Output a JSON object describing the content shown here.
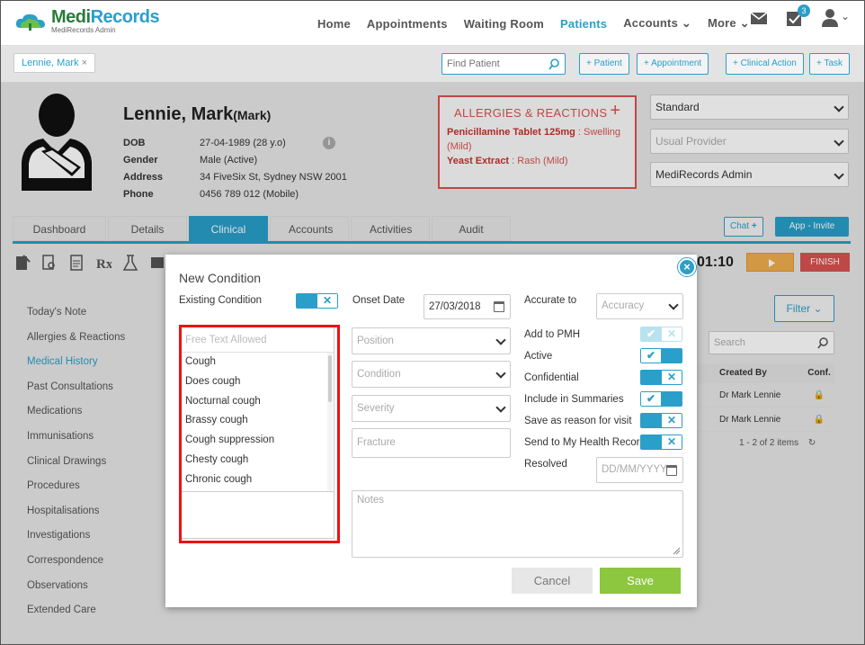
{
  "app": {
    "logo_title_1": "Medi",
    "logo_title_2": "Records",
    "logo_subtitle": "MediRecords Admin"
  },
  "nav": {
    "items": [
      {
        "label": "Home",
        "active": false
      },
      {
        "label": "Appointments",
        "active": false
      },
      {
        "label": "Waiting Room",
        "active": false
      },
      {
        "label": "Patients",
        "active": true
      },
      {
        "label": "Accounts",
        "active": false
      },
      {
        "label": "More",
        "active": false
      }
    ],
    "tasks_badge": "3",
    "accent": "#2a9fc9"
  },
  "toolbar": {
    "patient_chip": "Lennie, Mark",
    "find_placeholder": "Find Patient",
    "add_patient": "+ Patient",
    "add_appointment": "+ Appointment",
    "add_clinical_action": "+ Clinical Action",
    "add_task": "+ Task"
  },
  "patient": {
    "name": "Lennie, Mark",
    "preferred": "(Mark)",
    "fields": [
      {
        "key": "DOB",
        "value": "27-04-1989 (28 y.o)"
      },
      {
        "key": "Gender",
        "value": "Male (Active)"
      },
      {
        "key": "Address",
        "value": "34 FiveSix St, Sydney NSW 2001"
      },
      {
        "key": "Phone",
        "value": "0456 789 012 (Mobile)"
      }
    ]
  },
  "allergies": {
    "title": "ALLERGIES & REACTIONS",
    "items": [
      {
        "name": "Penicillamine Tablet 125mg",
        "reaction": "Swelling (Mild)"
      },
      {
        "name": "Yeast Extract",
        "reaction": "Rash (Mild)"
      }
    ],
    "color": "#d9534f"
  },
  "header_selects": {
    "type": "Standard",
    "provider_placeholder": "Usual Provider",
    "practice": "MediRecords Admin"
  },
  "tabs": [
    {
      "label": "Dashboard",
      "active": false
    },
    {
      "label": "Details",
      "active": false
    },
    {
      "label": "Clinical",
      "active": true
    },
    {
      "label": "Accounts",
      "active": false
    },
    {
      "label": "Activities",
      "active": false
    },
    {
      "label": "Audit",
      "active": false
    }
  ],
  "chat_label": "Chat",
  "invite_label": "App - Invite",
  "timer": "01:10",
  "finish_label": "FINISH",
  "left_menu": [
    {
      "label": "Today's Note",
      "active": false
    },
    {
      "label": "Allergies & Reactions",
      "active": false
    },
    {
      "label": "Medical History",
      "active": true
    },
    {
      "label": "Past Consultations",
      "active": false
    },
    {
      "label": "Medications",
      "active": false
    },
    {
      "label": "Immunisations",
      "active": false
    },
    {
      "label": "Clinical Drawings",
      "active": false
    },
    {
      "label": "Procedures",
      "active": false
    },
    {
      "label": "Hospitalisations",
      "active": false
    },
    {
      "label": "Investigations",
      "active": false
    },
    {
      "label": "Correspondence",
      "active": false
    },
    {
      "label": "Observations",
      "active": false
    },
    {
      "label": "Extended Care",
      "active": false
    }
  ],
  "history_panel": {
    "filter_label": "Filter",
    "search_placeholder": "Search",
    "col_created_by": "Created By",
    "col_conf": "Conf.",
    "rows": [
      {
        "created_by": "Dr Mark Lennie"
      },
      {
        "created_by": "Dr Mark Lennie"
      }
    ],
    "pager": "1 - 2 of 2 items"
  },
  "modal": {
    "title": "New Condition",
    "existing_condition_label": "Existing Condition",
    "existing_condition_on": false,
    "free_text_placeholder": "Free Text Allowed",
    "suggestions": [
      "Cough",
      "Does cough",
      "Nocturnal cough",
      "Brassy cough",
      "Cough suppression",
      "Chesty cough",
      "Chronic cough"
    ],
    "onset_date_label": "Onset Date",
    "onset_date_value": "27/03/2018",
    "position_placeholder": "Position",
    "condition_placeholder": "Condition",
    "severity_placeholder": "Severity",
    "fracture_placeholder": "Fracture",
    "accurate_to_label": "Accurate to",
    "accuracy_placeholder": "Accuracy",
    "flags": [
      {
        "label": "Add to PMH",
        "state": "disabled-on"
      },
      {
        "label": "Active",
        "state": "on"
      },
      {
        "label": "Confidential",
        "state": "off"
      },
      {
        "label": "Include in Summaries",
        "state": "on"
      },
      {
        "label": "Save as reason for visit",
        "state": "off"
      },
      {
        "label": "Send to My Health Record",
        "state": "off"
      }
    ],
    "resolved_label": "Resolved",
    "resolved_placeholder": "DD/MM/YYYY",
    "notes_placeholder": "Notes",
    "cancel_label": "Cancel",
    "save_label": "Save"
  }
}
